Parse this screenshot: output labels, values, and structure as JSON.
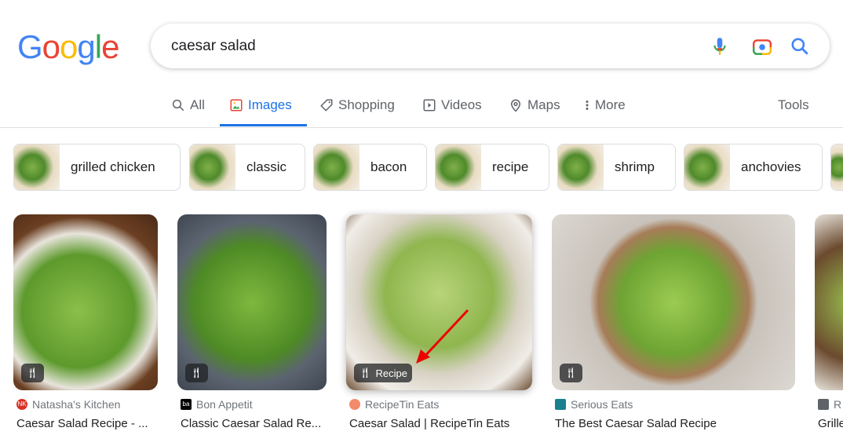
{
  "logo": "Google",
  "search": {
    "query": "caesar salad"
  },
  "tabs": [
    {
      "label": "All",
      "icon": "search-icon"
    },
    {
      "label": "Images",
      "icon": "image-icon",
      "active": true
    },
    {
      "label": "Shopping",
      "icon": "tag-icon"
    },
    {
      "label": "Videos",
      "icon": "play-icon"
    },
    {
      "label": "Maps",
      "icon": "pin-icon"
    },
    {
      "label": "More",
      "icon": "dots-vertical-icon"
    }
  ],
  "tools": "Tools",
  "chips": [
    "grilled chicken",
    "classic",
    "bacon",
    "recipe",
    "shrimp",
    "anchovies"
  ],
  "results": [
    {
      "source": "Natasha's Kitchen",
      "title": "Caesar Salad Recipe - ...",
      "badge": ""
    },
    {
      "source": "Bon Appetit",
      "title": "Classic Caesar Salad Re...",
      "badge": ""
    },
    {
      "source": "RecipeTin Eats",
      "title": "Caesar Salad | RecipeTin Eats",
      "badge": "Recipe"
    },
    {
      "source": "Serious Eats",
      "title": "The Best Caesar Salad Recipe",
      "badge": ""
    },
    {
      "source": "R",
      "title": "Grille",
      "badge": ""
    }
  ],
  "colors": {
    "accent": "#1a73e8",
    "blue": "#4285f4",
    "red": "#ea4335",
    "yellow": "#fbbc05",
    "green": "#34a853"
  }
}
